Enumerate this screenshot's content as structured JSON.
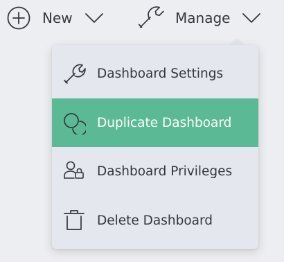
{
  "toolbar": {
    "new_label": "New",
    "manage_label": "Manage",
    "icons": {
      "new": "plus-circle-icon",
      "manage": "wrench-icon",
      "chevron": "chevron-down-icon"
    }
  },
  "menu": {
    "items": [
      {
        "label": "Dashboard Settings",
        "icon": "wrench-icon",
        "active": false
      },
      {
        "label": "Duplicate Dashboard",
        "icon": "duplicate-icon",
        "active": true
      },
      {
        "label": "Dashboard Privileges",
        "icon": "user-lock-icon",
        "active": false
      },
      {
        "label": "Delete Dashboard",
        "icon": "trash-icon",
        "active": false
      }
    ]
  },
  "colors": {
    "background": "#eceef1",
    "menu_background": "#e4e7ed",
    "highlight": "#5bba95",
    "text": "#33373d",
    "highlight_text": "#ffffff"
  }
}
